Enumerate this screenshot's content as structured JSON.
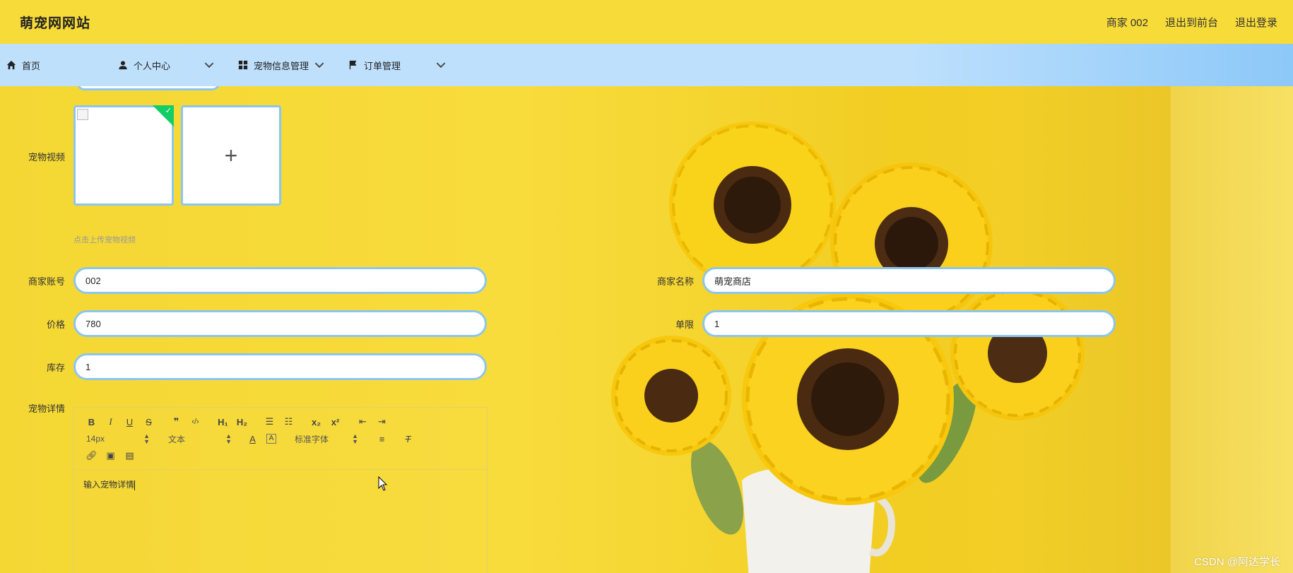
{
  "header": {
    "site_title": "萌宠网网站",
    "user_label": "商家 002",
    "back_to_front": "退出到前台",
    "logout": "退出登录"
  },
  "nav": {
    "items": [
      {
        "label": "首页",
        "icon": "home-icon"
      },
      {
        "label": "个人中心",
        "icon": "user-icon"
      },
      {
        "label": "宠物信息管理",
        "icon": "grid-icon"
      },
      {
        "label": "订单管理",
        "icon": "flag-icon"
      }
    ]
  },
  "form": {
    "video_label": "宠物视频",
    "upload_hint": "点击上传宠物视频",
    "merchant_account_label": "商家账号",
    "merchant_account_value": "002",
    "merchant_name_label": "商家名称",
    "merchant_name_value": "萌宠商店",
    "price_label": "价格",
    "price_value": "780",
    "limit_label": "单限",
    "limit_value": "1",
    "stock_label": "库存",
    "stock_value": "1",
    "detail_label": "宠物详情"
  },
  "editor": {
    "font_size": "14px",
    "header_select": "文本",
    "font_family": "标准字体",
    "placeholder": "输入宠物详情"
  },
  "watermark": "CSDN @阿达学长",
  "colors": {
    "header_bg": "#f7db38",
    "nav_bg": "#bee0fd",
    "input_border": "#8bc6ef",
    "success": "#13ce66"
  }
}
